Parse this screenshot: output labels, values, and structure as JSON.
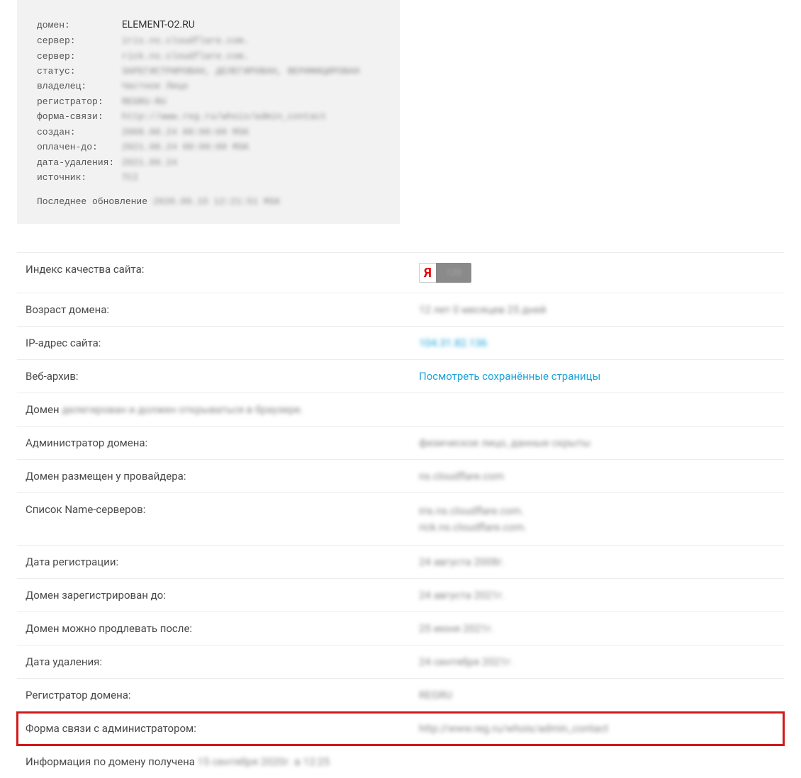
{
  "whois": {
    "rows": [
      {
        "label": "домен:",
        "value": "ELEMENT-O2.RU",
        "clear": true
      },
      {
        "label": "сервер:",
        "value": "iris.ns.cloudflare.com."
      },
      {
        "label": "сервер:",
        "value": "rick.ns.cloudflare.com."
      },
      {
        "label": "статус:",
        "value": "ЗАРЕГИСТРИРОВАН, ДЕЛЕГИРОВАН, ВЕРИФИЦИРОВАН"
      },
      {
        "label": "владелец:",
        "value": "Частное Лицо"
      },
      {
        "label": "регистратор:",
        "value": "REGRU-RU"
      },
      {
        "label": "форма-связи:",
        "value": "http://www.reg.ru/whois/admin_contact"
      },
      {
        "label": "создан:",
        "value": "2008.08.24 00:00:00 MSK"
      },
      {
        "label": "оплачен-до:",
        "value": "2021.08.24 00:00:00 MSK"
      },
      {
        "label": "дата-удаления:",
        "value": "2021.09.24"
      },
      {
        "label": "источник:",
        "value": "TCI"
      }
    ],
    "updateLabel": "Последнее обновление",
    "updateValue": "2020.09.15 12:21:51 MSK"
  },
  "info": {
    "quality": {
      "label": "Индекс качества сайта:",
      "badge": {
        "letter": "Я",
        "score": "120"
      }
    },
    "age": {
      "label": "Возраст домена:",
      "value": "12 лет 0 месяцев 25 дней"
    },
    "ip": {
      "label": "IP-адрес сайта:",
      "value": "104.31.82.136"
    },
    "archive": {
      "label": "Веб-архив:",
      "value": "Посмотреть сохранённые страницы"
    },
    "delegated": {
      "prefix": "Домен",
      "rest": "делегирован и должен открываться в браузере."
    },
    "admin": {
      "label": "Администратор домена:",
      "value": "физическое лицо, данные скрыты"
    },
    "provider": {
      "label": "Домен размещен у провайдера:",
      "value": "ns.cloudflare.com"
    },
    "ns": {
      "label": "Список Name-серверов:",
      "value1": "iris.ns.cloudflare.com.",
      "value2": "rick.ns.cloudflare.com."
    },
    "regdate": {
      "label": "Дата регистрации:",
      "value": "24 августа 2008г."
    },
    "reguntil": {
      "label": "Домен зарегистрирован до:",
      "value": "24 августа 2021г."
    },
    "renewafter": {
      "label": "Домен можно продлевать после:",
      "value": "25 июня 2021г."
    },
    "deldate": {
      "label": "Дата удаления:",
      "value": "24 сентября 2021г."
    },
    "registrar": {
      "label": "Регистратор домена:",
      "value": "REGRU"
    },
    "contactform": {
      "label": "Форма связи с администратором:",
      "value": "http://www.reg.ru/whois/admin_contact"
    },
    "retrieved": {
      "prefix": "Информация по домену получена",
      "rest": "15 сентября 2020г. в 12:25"
    }
  }
}
